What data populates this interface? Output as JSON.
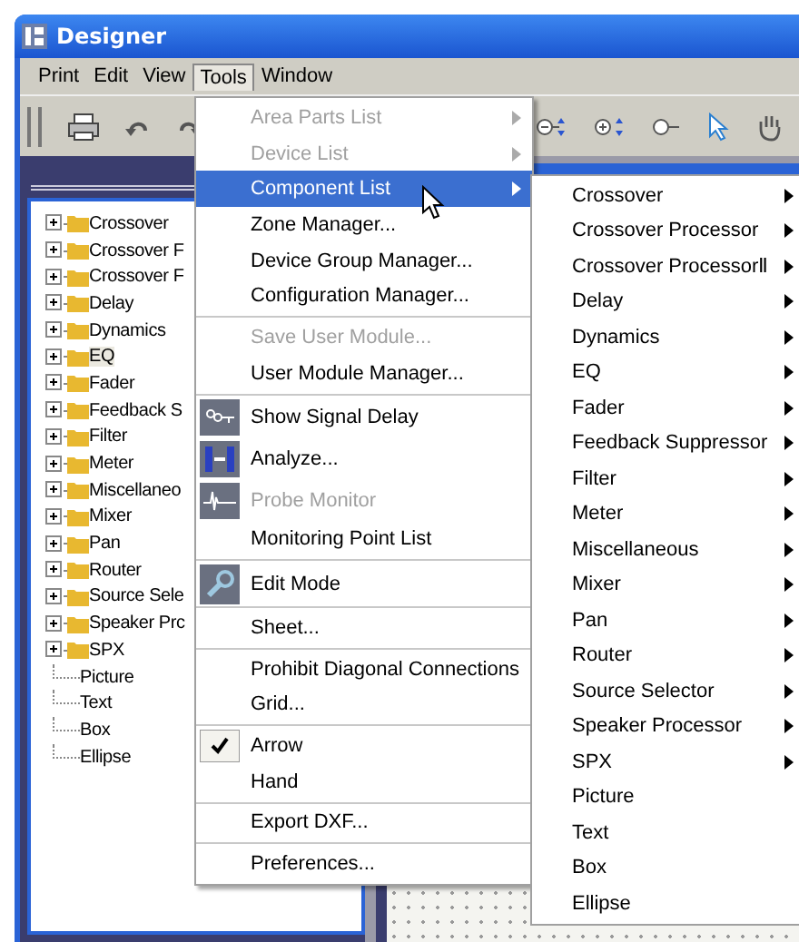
{
  "window": {
    "title": "Designer"
  },
  "menu_bar": [
    {
      "label": "Print",
      "selected": false
    },
    {
      "label": "Edit",
      "selected": false
    },
    {
      "label": "View",
      "selected": false
    },
    {
      "label": "Tools",
      "selected": true
    },
    {
      "label": "Window",
      "selected": false
    }
  ],
  "tree": {
    "items": [
      {
        "label": "Crossover",
        "kind": "folder",
        "selected": false
      },
      {
        "label": "Crossover F",
        "kind": "folder",
        "selected": false
      },
      {
        "label": "Crossover F",
        "kind": "folder",
        "selected": false
      },
      {
        "label": "Delay",
        "kind": "folder",
        "selected": false
      },
      {
        "label": "Dynamics",
        "kind": "folder",
        "selected": false
      },
      {
        "label": "EQ",
        "kind": "folder",
        "selected": true
      },
      {
        "label": "Fader",
        "kind": "folder",
        "selected": false
      },
      {
        "label": "Feedback S",
        "kind": "folder",
        "selected": false
      },
      {
        "label": "Filter",
        "kind": "folder",
        "selected": false
      },
      {
        "label": "Meter",
        "kind": "folder",
        "selected": false
      },
      {
        "label": "Miscellaneo",
        "kind": "folder",
        "selected": false
      },
      {
        "label": "Mixer",
        "kind": "folder",
        "selected": false
      },
      {
        "label": "Pan",
        "kind": "folder",
        "selected": false
      },
      {
        "label": "Router",
        "kind": "folder",
        "selected": false
      },
      {
        "label": "Source Sele",
        "kind": "folder",
        "selected": false
      },
      {
        "label": "Speaker Prc",
        "kind": "folder",
        "selected": false
      },
      {
        "label": "SPX",
        "kind": "folder",
        "selected": false
      },
      {
        "label": "Picture",
        "kind": "leaf",
        "selected": false
      },
      {
        "label": "Text",
        "kind": "leaf",
        "selected": false
      },
      {
        "label": "Box",
        "kind": "leaf",
        "selected": false
      },
      {
        "label": "Ellipse",
        "kind": "leaf",
        "selected": false
      }
    ]
  },
  "tools_menu": {
    "items": [
      {
        "kind": "submenu",
        "label": "Area Parts List",
        "disabled": true,
        "selected": false,
        "checked": false
      },
      {
        "kind": "submenu",
        "label": "Device List",
        "disabled": true,
        "selected": false,
        "checked": false
      },
      {
        "kind": "submenu",
        "label": "Component List",
        "disabled": false,
        "selected": true,
        "checked": false
      },
      {
        "kind": "command",
        "label": "Zone Manager...",
        "disabled": false,
        "selected": false,
        "checked": false
      },
      {
        "kind": "command",
        "label": "Device Group Manager...",
        "disabled": false,
        "selected": false,
        "checked": false
      },
      {
        "kind": "command",
        "label": "Configuration Manager...",
        "disabled": false,
        "selected": false,
        "checked": false
      },
      {
        "kind": "separator"
      },
      {
        "kind": "command",
        "label": "Save User Module...",
        "disabled": true,
        "selected": false,
        "checked": false
      },
      {
        "kind": "command",
        "label": "User Module Manager...",
        "disabled": false,
        "selected": false,
        "checked": false
      },
      {
        "kind": "separator"
      },
      {
        "kind": "command",
        "label": "Show Signal Delay",
        "disabled": false,
        "selected": false,
        "checked": false
      },
      {
        "kind": "command",
        "label": "Analyze...",
        "disabled": false,
        "selected": false,
        "checked": false
      },
      {
        "kind": "command",
        "label": "Probe Monitor",
        "disabled": true,
        "selected": false,
        "checked": false
      },
      {
        "kind": "command",
        "label": "Monitoring Point List",
        "disabled": false,
        "selected": false,
        "checked": false
      },
      {
        "kind": "separator"
      },
      {
        "kind": "command",
        "label": "Edit Mode",
        "disabled": false,
        "selected": false,
        "checked": false
      },
      {
        "kind": "separator"
      },
      {
        "kind": "command",
        "label": "Sheet...",
        "disabled": false,
        "selected": false,
        "checked": false
      },
      {
        "kind": "separator"
      },
      {
        "kind": "command",
        "label": "Prohibit Diagonal Connections",
        "disabled": false,
        "selected": false,
        "checked": false
      },
      {
        "kind": "command",
        "label": "Grid...",
        "disabled": false,
        "selected": false,
        "checked": false
      },
      {
        "kind": "separator"
      },
      {
        "kind": "command",
        "label": "Arrow",
        "disabled": false,
        "selected": false,
        "checked": true
      },
      {
        "kind": "command",
        "label": "Hand",
        "disabled": false,
        "selected": false,
        "checked": false
      },
      {
        "kind": "separator"
      },
      {
        "kind": "command",
        "label": "Export DXF...",
        "disabled": false,
        "selected": false,
        "checked": false
      },
      {
        "kind": "separator"
      },
      {
        "kind": "command",
        "label": "Preferences...",
        "disabled": false,
        "selected": false,
        "checked": false
      }
    ]
  },
  "component_submenu": {
    "items": [
      {
        "label": "Crossover",
        "has_submenu": true
      },
      {
        "label": "Crossover Processor",
        "has_submenu": true
      },
      {
        "label": "Crossover ProcessorⅡ",
        "has_submenu": true
      },
      {
        "label": "Delay",
        "has_submenu": true
      },
      {
        "label": "Dynamics",
        "has_submenu": true
      },
      {
        "label": "EQ",
        "has_submenu": true
      },
      {
        "label": "Fader",
        "has_submenu": true
      },
      {
        "label": "Feedback Suppressor",
        "has_submenu": true
      },
      {
        "label": "Filter",
        "has_submenu": true
      },
      {
        "label": "Meter",
        "has_submenu": true
      },
      {
        "label": "Miscellaneous",
        "has_submenu": true
      },
      {
        "label": "Mixer",
        "has_submenu": true
      },
      {
        "label": "Pan",
        "has_submenu": true
      },
      {
        "label": "Router",
        "has_submenu": true
      },
      {
        "label": "Source Selector",
        "has_submenu": true
      },
      {
        "label": "Speaker Processor",
        "has_submenu": true
      },
      {
        "label": "SPX",
        "has_submenu": true
      },
      {
        "label": "Picture",
        "has_submenu": false
      },
      {
        "label": "Text",
        "has_submenu": false
      },
      {
        "label": "Box",
        "has_submenu": false
      },
      {
        "label": "Ellipse",
        "has_submenu": false
      }
    ]
  }
}
